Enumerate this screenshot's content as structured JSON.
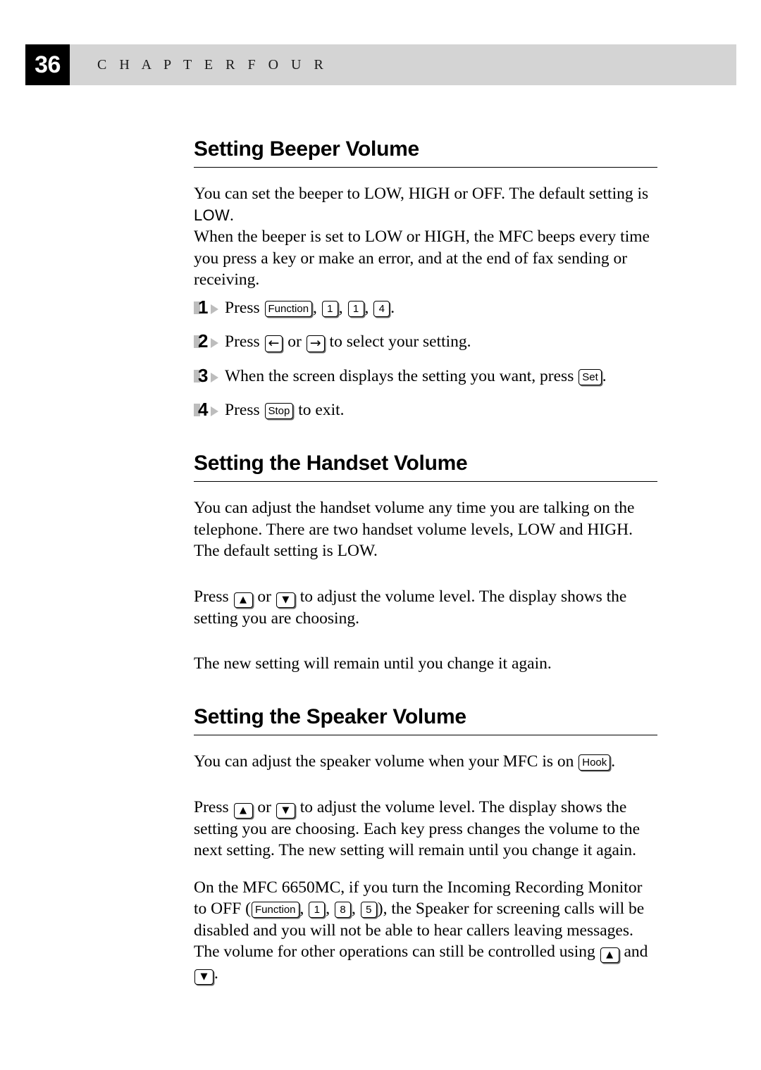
{
  "header": {
    "page_number": "36",
    "chapter_label": "C H A P T E R   F O U R"
  },
  "sections": [
    {
      "id": "beeper-volume",
      "heading": "Setting Beeper Volume",
      "intro_1": "You can set the beeper to LOW, HIGH or OFF. The default setting is ",
      "intro_lcd": "LOW",
      "intro_2": ".",
      "intro_3": "When the beeper is set to LOW or HIGH, the MFC beeps every time you press a key or make an error, and at the end of fax sending or receiving.",
      "steps": [
        {
          "number": "1",
          "parts": [
            {
              "type": "text",
              "value": "Press "
            },
            {
              "type": "key",
              "value": "Function"
            },
            {
              "type": "text",
              "value": ", "
            },
            {
              "type": "key",
              "value": "1"
            },
            {
              "type": "text",
              "value": ", "
            },
            {
              "type": "key",
              "value": "1"
            },
            {
              "type": "text",
              "value": ", "
            },
            {
              "type": "key",
              "value": "4"
            },
            {
              "type": "text",
              "value": "."
            }
          ]
        },
        {
          "number": "2",
          "parts": [
            {
              "type": "text",
              "value": "Press "
            },
            {
              "type": "key",
              "value": "←"
            },
            {
              "type": "text",
              "value": " or "
            },
            {
              "type": "key",
              "value": "→"
            },
            {
              "type": "text",
              "value": " to select your setting."
            }
          ]
        },
        {
          "number": "3",
          "parts": [
            {
              "type": "text",
              "value": "When the screen displays the setting you want, press "
            },
            {
              "type": "key",
              "value": "Set"
            },
            {
              "type": "text",
              "value": "."
            }
          ]
        },
        {
          "number": "4",
          "parts": [
            {
              "type": "text",
              "value": "Press "
            },
            {
              "type": "key",
              "value": "Stop"
            },
            {
              "type": "text",
              "value": " to exit."
            }
          ]
        }
      ]
    },
    {
      "id": "handset-volume",
      "heading": "Setting the Handset Volume",
      "para_1": "You can adjust the handset volume any time you are talking on the telephone. There are two handset volume levels, LOW and HIGH. The default setting is LOW.",
      "para_2_pre": "Press ",
      "key_up": "▲",
      "para_2_mid": " or ",
      "key_down": "▼",
      "para_2_post": " to adjust the volume level. The display shows the setting you are choosing.",
      "para_3": "The new setting will remain until you change it again."
    },
    {
      "id": "speaker-volume",
      "heading": "Setting the Speaker Volume",
      "para_1_pre": "You can adjust the speaker volume when your MFC is on ",
      "key_hook": "Hook",
      "para_1_post": ".",
      "para_2_pre": "Press ",
      "key_up": "▲",
      "para_2_mid": " or ",
      "key_down": "▼",
      "para_2_post": " to adjust the volume level. The display shows the setting you are choosing. Each key press changes the volume to the next setting. The new setting will remain until you change it again.",
      "para_3_a": "On the MFC 6650MC, if you turn the Incoming Recording Monitor to OFF (",
      "key_function": "Function",
      "sep_1": ", ",
      "key_1": "1",
      "sep_2": ", ",
      "key_8": "8",
      "sep_3": ", ",
      "key_5": "5",
      "para_3_b": "), the Speaker for screening calls will be disabled and you will not be able to hear callers leaving messages. The volume for other operations can still be controlled using ",
      "key_up2": "▲",
      "para_3_c": " and ",
      "key_down2": "▼",
      "para_3_d": "."
    }
  ],
  "colors": {
    "page_number_bg": "#000000",
    "chapter_bar_bg": "#d4d4d4",
    "text": "#000000",
    "step_marker": "#bdbdbd"
  }
}
